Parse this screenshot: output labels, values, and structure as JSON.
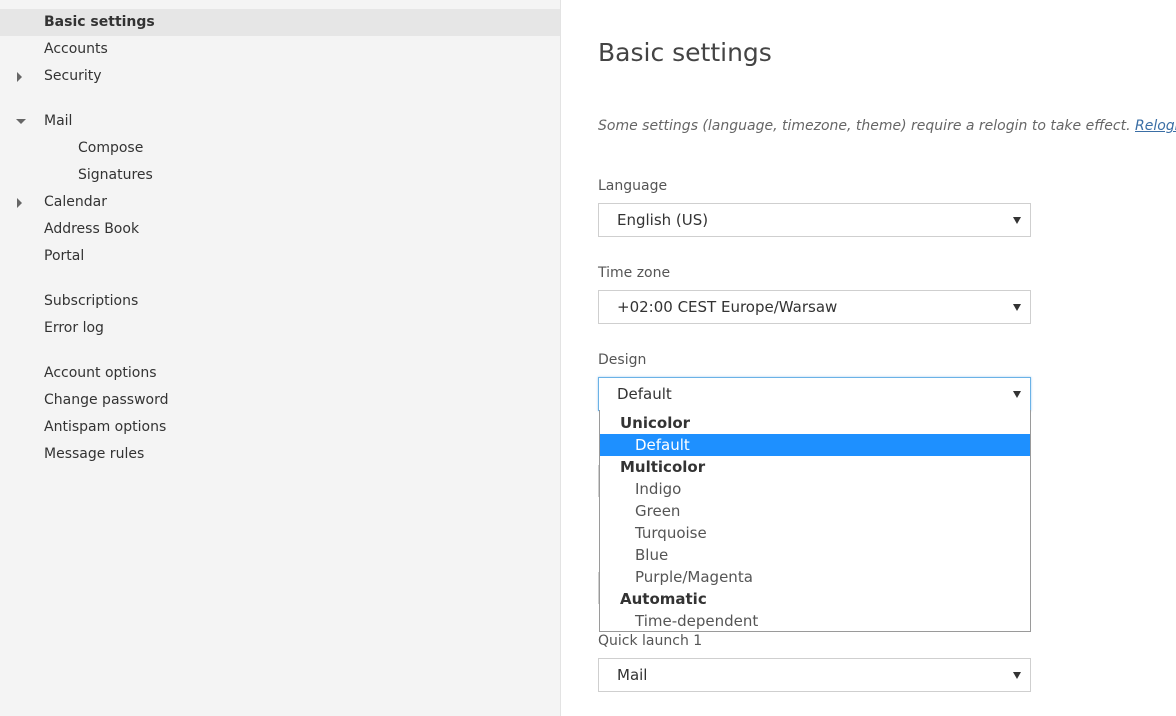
{
  "sidebar": {
    "items": [
      {
        "label": "Basic settings"
      },
      {
        "label": "Accounts"
      },
      {
        "label": "Security"
      },
      {
        "label": "Mail"
      },
      {
        "label": "Compose"
      },
      {
        "label": "Signatures"
      },
      {
        "label": "Calendar"
      },
      {
        "label": "Address Book"
      },
      {
        "label": "Portal"
      },
      {
        "label": "Subscriptions"
      },
      {
        "label": "Error log"
      },
      {
        "label": "Account options"
      },
      {
        "label": "Change password"
      },
      {
        "label": "Antispam options"
      },
      {
        "label": "Message rules"
      }
    ]
  },
  "main": {
    "title": "Basic settings",
    "note": "Some settings (language, timezone, theme) require a relogin to take effect.",
    "relogin_link": "Relogin",
    "language": {
      "label": "Language",
      "value": "English (US)"
    },
    "timezone": {
      "label": "Time zone",
      "value": "+02:00 CEST Europe/Warsaw"
    },
    "design": {
      "label": "Design",
      "value": "Default",
      "options": [
        {
          "label": "Unicolor"
        },
        {
          "label": "Default"
        },
        {
          "label": "Multicolor"
        },
        {
          "label": "Indigo"
        },
        {
          "label": "Green"
        },
        {
          "label": "Turquoise"
        },
        {
          "label": "Blue"
        },
        {
          "label": "Purple/Magenta"
        },
        {
          "label": "Automatic"
        },
        {
          "label": "Time-dependent"
        }
      ]
    },
    "quick_launch_1": {
      "label": "Quick launch 1",
      "value": "Mail"
    }
  },
  "colors": {
    "sidebar_bg": "#f4f4f4",
    "active_item_bg": "#e6e6e6",
    "selected_option_bg": "#1e90ff",
    "link": "#3a6ea5"
  },
  "icons": {
    "collapsed": "caret-right-icon",
    "expanded": "caret-down-icon",
    "select_arrow": "dropdown-arrow-icon"
  }
}
